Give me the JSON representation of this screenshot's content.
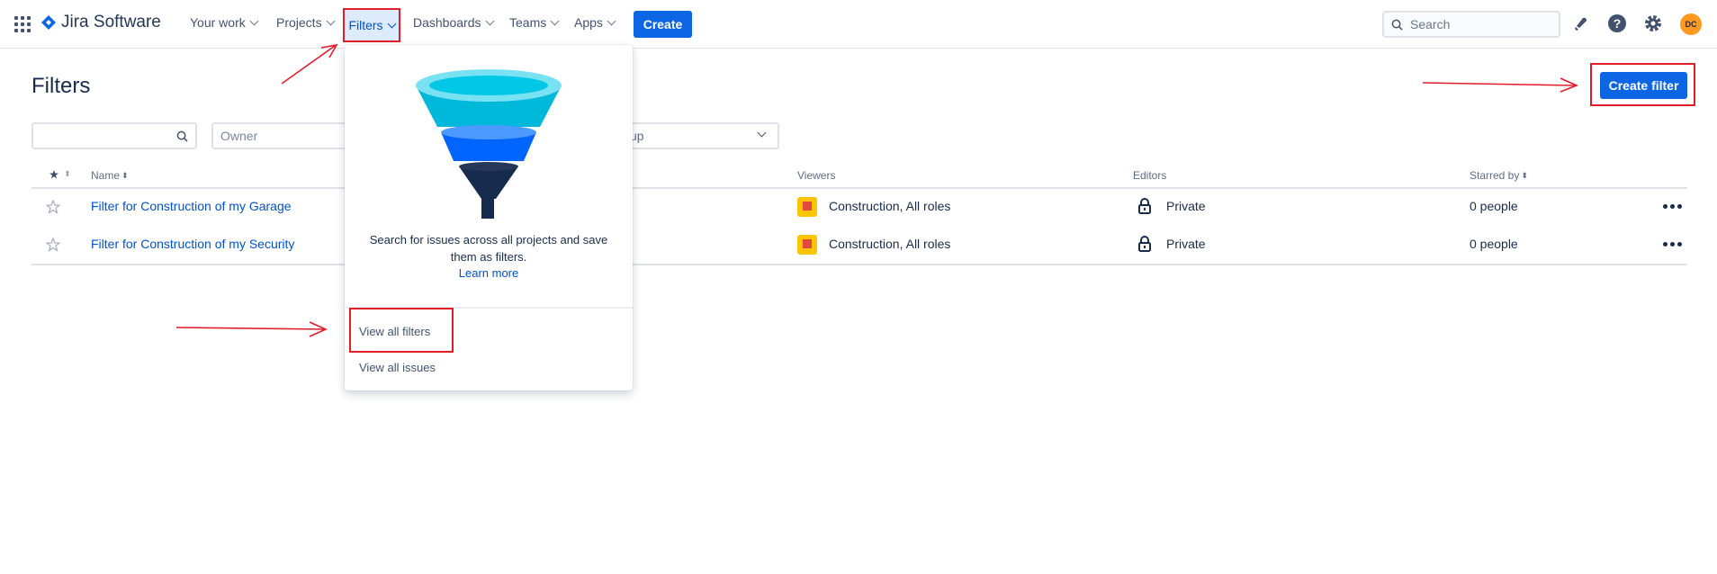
{
  "app": {
    "logo_text": "Jira Software",
    "brand_color": "#0c66e4",
    "highlight_color": "#e11d2a"
  },
  "nav": {
    "items": [
      {
        "label": "Your work"
      },
      {
        "label": "Projects"
      },
      {
        "label": "Filters"
      },
      {
        "label": "Dashboards"
      },
      {
        "label": "Teams"
      },
      {
        "label": "Apps"
      }
    ],
    "create_label": "Create",
    "search_placeholder": "Search",
    "avatar_initials": "DC"
  },
  "page": {
    "title": "Filters",
    "create_filter_label": "Create filter",
    "owner_placeholder": "Owner",
    "group_partial": "up"
  },
  "table": {
    "headers": {
      "name": "Name",
      "viewers": "Viewers",
      "editors": "Editors",
      "starred_by": "Starred by"
    },
    "rows": [
      {
        "name": "Filter for Construction of my Garage",
        "viewers": "Construction, All roles",
        "editors": "Private",
        "starred_by": "0 people"
      },
      {
        "name": "Filter for Construction of my Security",
        "viewers": "Construction, All roles",
        "editors": "Private",
        "starred_by": "0 people"
      }
    ]
  },
  "dropdown": {
    "description": "Search for issues across all projects and save them as filters.",
    "learn_more": "Learn more",
    "view_all_filters": "View all filters",
    "view_all_issues": "View all issues"
  }
}
